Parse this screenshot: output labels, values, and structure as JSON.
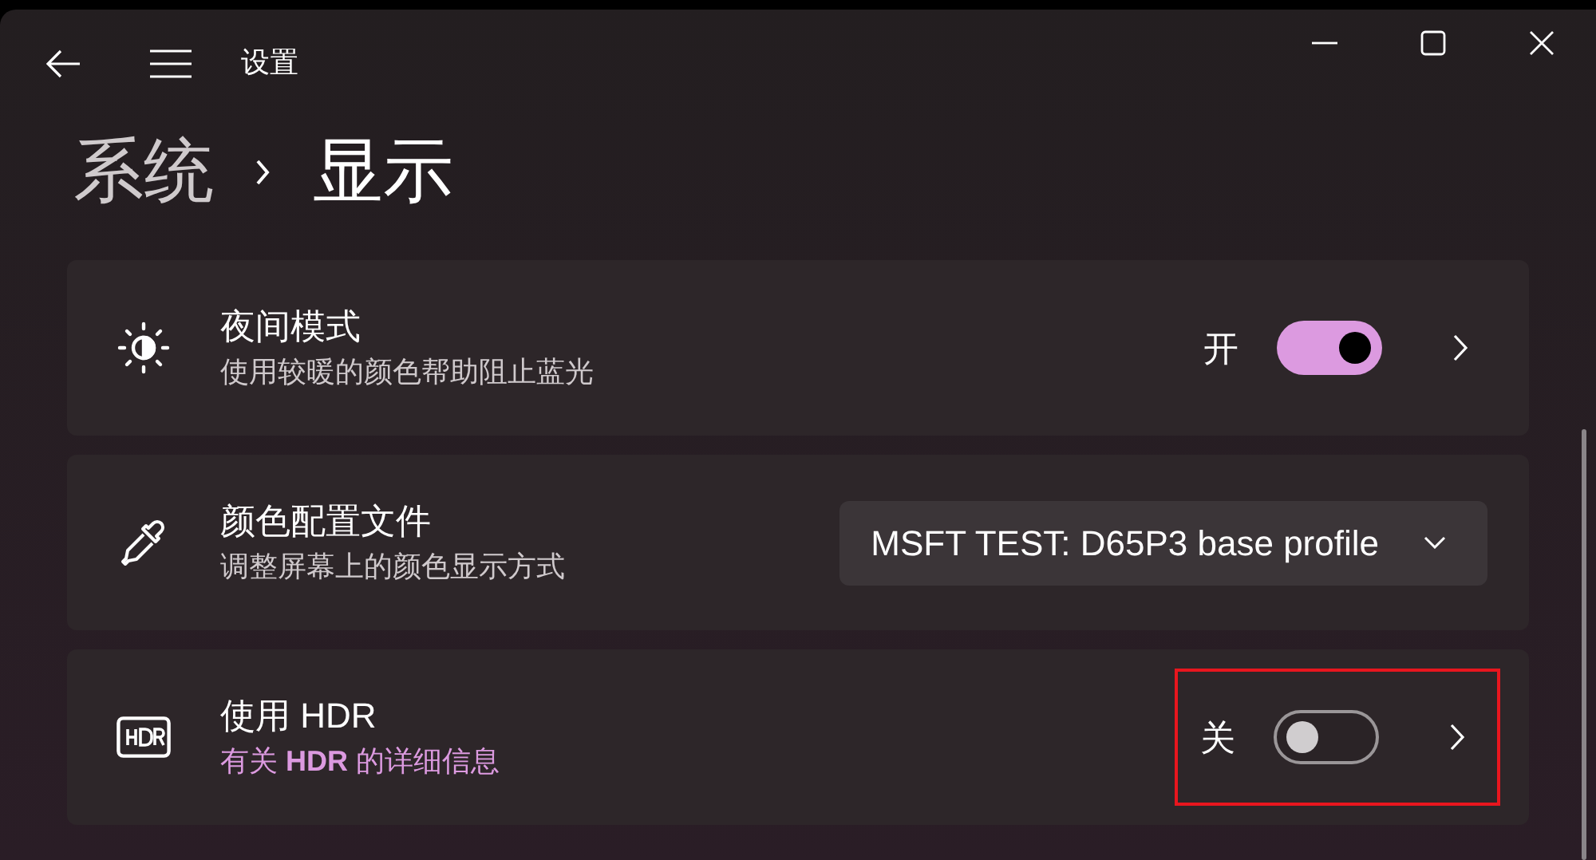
{
  "window": {
    "title": "设置"
  },
  "breadcrumb": [
    {
      "label": "系统",
      "current": false
    },
    {
      "label": "显示",
      "current": true
    }
  ],
  "settings": [
    {
      "kind": "toggle",
      "title": "夜间模式",
      "description": "使用较暖的颜色帮助阻止蓝光",
      "description_is_link": false,
      "state_label": "开",
      "on": true,
      "highlighted": false
    },
    {
      "kind": "dropdown",
      "title": "颜色配置文件",
      "description": "调整屏幕上的颜色显示方式",
      "description_is_link": false,
      "value": "MSFT TEST: D65P3 base profile"
    },
    {
      "kind": "toggle",
      "title": "使用 HDR",
      "description": "有关 **HDR** 的详细信息",
      "description_is_link": true,
      "state_label": "关",
      "on": false,
      "highlighted": true
    }
  ]
}
